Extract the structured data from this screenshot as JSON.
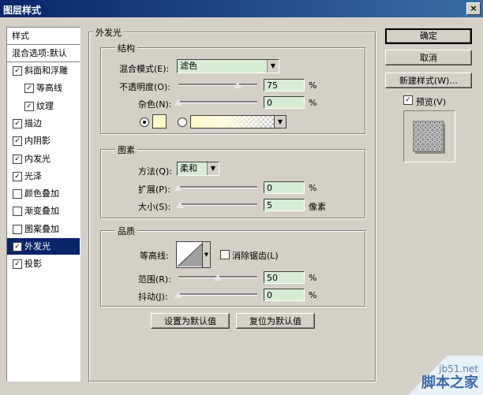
{
  "window": {
    "title": "图层样式",
    "close": "×"
  },
  "styles_list": {
    "header": "样式",
    "blend_default": "混合选项:默认",
    "items": [
      {
        "label": "斜面和浮雕",
        "checked": "✓"
      },
      {
        "label": "等高线",
        "checked": "✓"
      },
      {
        "label": "纹理",
        "checked": "✓"
      },
      {
        "label": "描边",
        "checked": "✓"
      },
      {
        "label": "内阴影",
        "checked": "✓"
      },
      {
        "label": "内发光",
        "checked": "✓"
      },
      {
        "label": "光泽",
        "checked": "✓"
      },
      {
        "label": "颜色叠加",
        "checked": ""
      },
      {
        "label": "渐变叠加",
        "checked": ""
      },
      {
        "label": "图案叠加",
        "checked": ""
      },
      {
        "label": "外发光",
        "checked": "✓"
      },
      {
        "label": "投影",
        "checked": "✓"
      }
    ]
  },
  "outer_glow": {
    "title": "外发光",
    "structure": {
      "title": "结构",
      "blend_mode_label": "混合模式(E):",
      "blend_mode_value": "滤色",
      "opacity_label": "不透明度(O):",
      "opacity_value": "75",
      "opacity_unit": "%",
      "opacity_fraction": 0.75,
      "noise_label": "杂色(N):",
      "noise_value": "0",
      "noise_unit": "%",
      "noise_fraction": 0.0,
      "color_swatch": "#fff8c8"
    },
    "elements": {
      "title": "图素",
      "technique_label": "方法(Q):",
      "technique_value": "柔和",
      "spread_label": "扩展(P):",
      "spread_value": "0",
      "spread_unit": "%",
      "spread_fraction": 0.0,
      "size_label": "大小(S):",
      "size_value": "5",
      "size_unit": "像素",
      "size_fraction": 0.02
    },
    "quality": {
      "title": "品质",
      "contour_label": "等高线:",
      "antialias_label": "消除锯齿(L)",
      "range_label": "范围(R):",
      "range_value": "50",
      "range_unit": "%",
      "range_fraction": 0.5,
      "jitter_label": "抖动(J):",
      "jitter_value": "0",
      "jitter_unit": "%",
      "jitter_fraction": 0.0
    },
    "set_default": "设置为默认值",
    "reset_default": "复位为默认值"
  },
  "buttons": {
    "ok": "确定",
    "cancel": "取消",
    "new_style": "新建样式(W)...",
    "preview_label": "预览(V)",
    "preview_checked": "✓"
  },
  "watermark": {
    "site": "jb51.net",
    "name": "脚本之家"
  }
}
